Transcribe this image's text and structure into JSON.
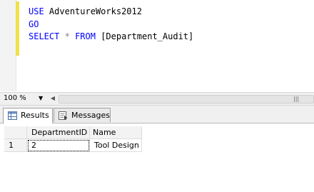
{
  "editor": {
    "lines": [
      {
        "kw": "USE",
        "rest": "AdventureWorks2012"
      },
      {
        "kw": "GO",
        "rest": ""
      },
      {
        "kw1": "SELECT",
        "op": "*",
        "kw2": "FROM",
        "obj": "[Department_Audit]"
      }
    ]
  },
  "zoom": {
    "value": "100 %"
  },
  "tabs": [
    {
      "label": "Results",
      "active": true
    },
    {
      "label": "Messages",
      "active": false
    }
  ],
  "grid": {
    "columns": [
      "DepartmentID",
      "Name"
    ],
    "rows": [
      {
        "num": "1",
        "cells": [
          "2",
          "Tool Design"
        ]
      }
    ]
  },
  "colors": {
    "keyword": "#0000ff",
    "operator": "#808080",
    "margin_bar": "#f0e04c"
  }
}
